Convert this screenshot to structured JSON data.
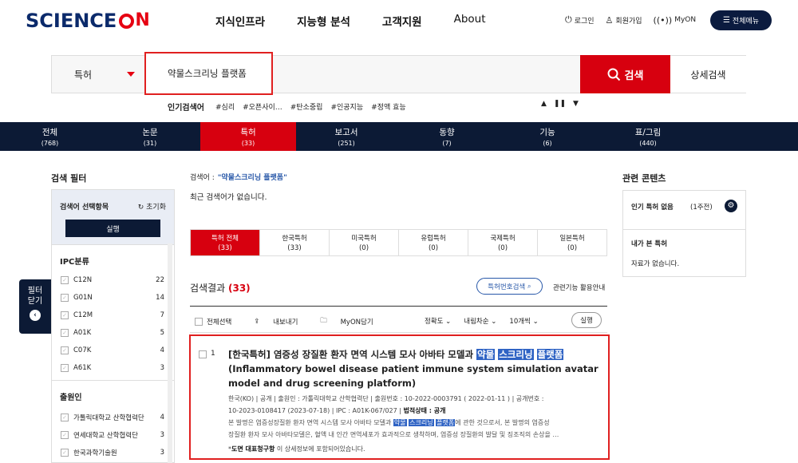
{
  "header": {
    "logo_text": "SCIENCE",
    "logo_suffix": "N",
    "nav": [
      "지식인프라",
      "지능형 분석",
      "고객지원",
      "About"
    ],
    "util": [
      {
        "icon": "power-icon",
        "glyph": "⏻",
        "label": "로그인"
      },
      {
        "icon": "add-user-icon",
        "glyph": "♙",
        "label": "회원가입"
      },
      {
        "icon": "signal-icon",
        "glyph": "((•))",
        "label": "MyON"
      }
    ],
    "all_menu": "전체메뉴"
  },
  "search": {
    "category": "특허",
    "query": "약물스크리닝 플랫폼",
    "button": "검색",
    "advanced": "상세검색"
  },
  "popular": {
    "label": "인기검색어",
    "items": [
      "#심리",
      "#오픈사이…",
      "#탄소중립",
      "#인공지능",
      "#정액 효능"
    ],
    "controls": [
      "▲",
      "❚❚",
      "▼"
    ]
  },
  "tabs": [
    {
      "label": "전체",
      "count": "(768)"
    },
    {
      "label": "논문",
      "count": "(31)"
    },
    {
      "label": "특허",
      "count": "(33)"
    },
    {
      "label": "보고서",
      "count": "(251)"
    },
    {
      "label": "동향",
      "count": "(7)"
    },
    {
      "label": "기능",
      "count": "(6)"
    },
    {
      "label": "표/그림",
      "count": "(440)"
    }
  ],
  "filter": {
    "title": "검색 필터",
    "head": "검색어 선택항목",
    "reset": "↻ 초기화",
    "run": "실행",
    "ipc_title": "IPC분류",
    "ipc": [
      {
        "code": "C12N",
        "count": "22"
      },
      {
        "code": "G01N",
        "count": "14"
      },
      {
        "code": "C12M",
        "count": "7"
      },
      {
        "code": "A01K",
        "count": "5"
      },
      {
        "code": "C07K",
        "count": "4"
      },
      {
        "code": "A61K",
        "count": "3"
      }
    ],
    "applicant_title": "출원인",
    "applicants": [
      {
        "name": "가톨릭대학교 산학협력단",
        "count": "4"
      },
      {
        "name": "연세대학교 산학협력단",
        "count": "3"
      },
      {
        "name": "한국과학기술원",
        "count": "3"
      }
    ],
    "close_line1": "필터",
    "close_line2": "닫기",
    "close_icon": "‹"
  },
  "main": {
    "keyword_label": "검색어 :",
    "keyword": "\"약물스크리닝 플랫폼\"",
    "recent": "최근 검색어가 없습니다.",
    "subtabs": [
      {
        "label": "특허 전체",
        "count": "(33)"
      },
      {
        "label": "한국특허",
        "count": "(33)"
      },
      {
        "label": "미국특허",
        "count": "(0)"
      },
      {
        "label": "유럽특허",
        "count": "(0)"
      },
      {
        "label": "국제특허",
        "count": "(0)"
      },
      {
        "label": "일본특허",
        "count": "(0)"
      }
    ],
    "results_label": "검색결과",
    "results_count": "(33)",
    "patent_num_search": "특허번호검색",
    "guide": "관련기능 활용안내",
    "tools": [
      "전체선택",
      "내보내기",
      "MyON담기"
    ],
    "sorts": [
      "정확도 ⌄",
      "내림차순 ⌄",
      "10개씩 ⌄"
    ],
    "run": "실행",
    "result": {
      "num": "1",
      "title_pre": "[한국특허] 염증성 장질환 환자 면역 시스템 모사 아바타 모델과",
      "hl1": "약물",
      "hl2": "스크리닝",
      "hl3": "플랫폼",
      "title_en": "(Inflammatory bowel disease patient immune system simulation avatar model and drug screening platform)",
      "meta1": "한국(KO) | 공개 | 출원인 : 가톨릭대학교 산학협력단 | 출원번호 : 10-2022-0003791 ( 2022-01-11 ) | 공개번호 :",
      "meta2": "10-2023-0108417 (2023-07-18) | IPC : A01K-067/027 |",
      "legal_label": "법적상태 : 공개",
      "abs_pre": "본 발명은 염증성장질환 환자 면역 시스템 모사 아바타 모델과",
      "abs_post": "에 관한 것으로서, 본 발명의 염증성",
      "abs2": "장질환 환자 모사 아바타모델은, 혈액 내 인간 면역세포가 효과적으로 생착하며, 염증성 장질환의 발달 및 징조직의 손상을 …",
      "note_prefix": "*",
      "note_bold": "도면 대표청구항",
      "note_rest": " 이 상세정보에 포함되어있습니다."
    }
  },
  "related": {
    "title": "관련 콘텐츠",
    "popular": "인기 특허 없음",
    "period": "(1주전)",
    "my_title": "내가 본 특허",
    "my_empty": "자료가 없습니다."
  }
}
